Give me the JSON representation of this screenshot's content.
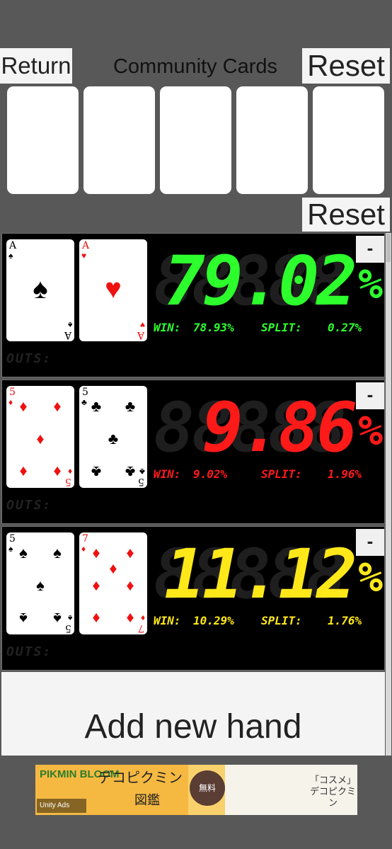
{
  "header": {
    "return_label": "Return",
    "title": "Community Cards",
    "reset_label": "Reset"
  },
  "hands_reset_label": "Reset",
  "colors": {
    "background": "#585858",
    "panel": "#000000",
    "green": "#2dff2d",
    "red": "#ff1a1a",
    "yellow": "#ffe81a"
  },
  "hands": [
    {
      "cards": [
        {
          "rank": "A",
          "suit": "♠",
          "color": "black"
        },
        {
          "rank": "A",
          "suit": "♥",
          "color": "red"
        }
      ],
      "equity": "79.02",
      "pct": "%",
      "win_label": "WIN:",
      "win_value": "78.93%",
      "split_label": "SPLIT:",
      "split_value": "0.27%",
      "outs_label": "OUTS:",
      "color": "#2dff2d",
      "remove_label": "-"
    },
    {
      "cards": [
        {
          "rank": "5",
          "suit": "♦",
          "color": "red"
        },
        {
          "rank": "5",
          "suit": "♣",
          "color": "black"
        }
      ],
      "equity": "9.86",
      "pct": "%",
      "win_label": "WIN:",
      "win_value": "9.02%",
      "split_label": "SPLIT:",
      "split_value": "1.96%",
      "outs_label": "OUTS:",
      "color": "#ff1a1a",
      "remove_label": "-"
    },
    {
      "cards": [
        {
          "rank": "5",
          "suit": "♠",
          "color": "black"
        },
        {
          "rank": "7",
          "suit": "♦",
          "color": "red"
        }
      ],
      "equity": "11.12",
      "pct": "%",
      "win_label": "WIN:",
      "win_value": "10.29%",
      "split_label": "SPLIT:",
      "split_value": "1.76%",
      "outs_label": "OUTS:",
      "color": "#ffe81a",
      "remove_label": "-"
    }
  ],
  "add_hand_label": "Add new hand",
  "ad": {
    "brand": "PIKMIN BLOOM",
    "headline": "デコピクミン",
    "sub": "図鑑",
    "badge": "無料",
    "right_text": "「コスメ」 デコピクミン",
    "unity_label": "Unity Ads"
  }
}
